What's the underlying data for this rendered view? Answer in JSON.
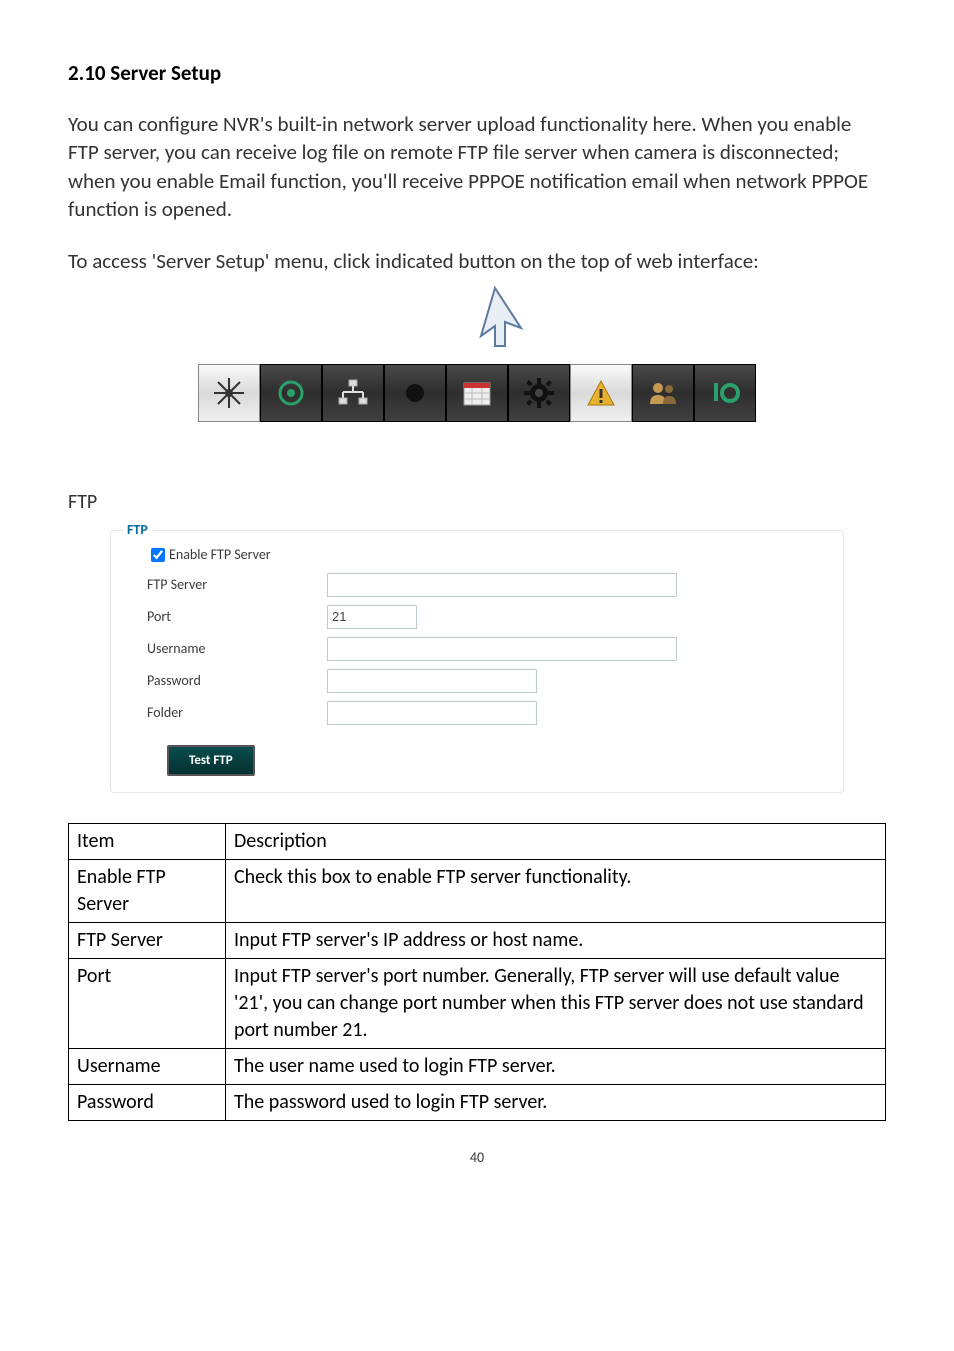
{
  "section_title": "2.10 Server Setup",
  "para1": "You can configure NVR's built-in network server upload functionality here. When you enable FTP server, you can receive log file on remote FTP file server when camera is disconnected; when you enable Email function, you'll receive PPPOE notification email when network PPPOE function is opened.",
  "para2": "To access 'Server Setup' menu, click indicated button on the top of web interface:",
  "ftp_heading": "FTP",
  "ftp_fieldset": {
    "legend": "FTP",
    "enable_label": "Enable FTP Server",
    "rows": {
      "server_label": "FTP Server",
      "port_label": "Port",
      "port_value": "21",
      "username_label": "Username",
      "password_label": "Password",
      "folder_label": "Folder"
    },
    "test_button": "Test FTP"
  },
  "table": {
    "header_item": "Item",
    "header_desc": "Description",
    "rows": [
      {
        "item": "Enable FTP Server",
        "desc": "Check this box to enable FTP server functionality."
      },
      {
        "item": "FTP Server",
        "desc": "Input FTP server's IP address or host name."
      },
      {
        "item": "Port",
        "desc": "Input FTP server's port number. Generally, FTP server will use default value '21', you can change port number when this FTP server does not use standard port number 21."
      },
      {
        "item": "Username",
        "desc": "The user name used to login FTP server."
      },
      {
        "item": "Password",
        "desc": "The password used to login FTP server."
      }
    ]
  },
  "page_number": "40"
}
